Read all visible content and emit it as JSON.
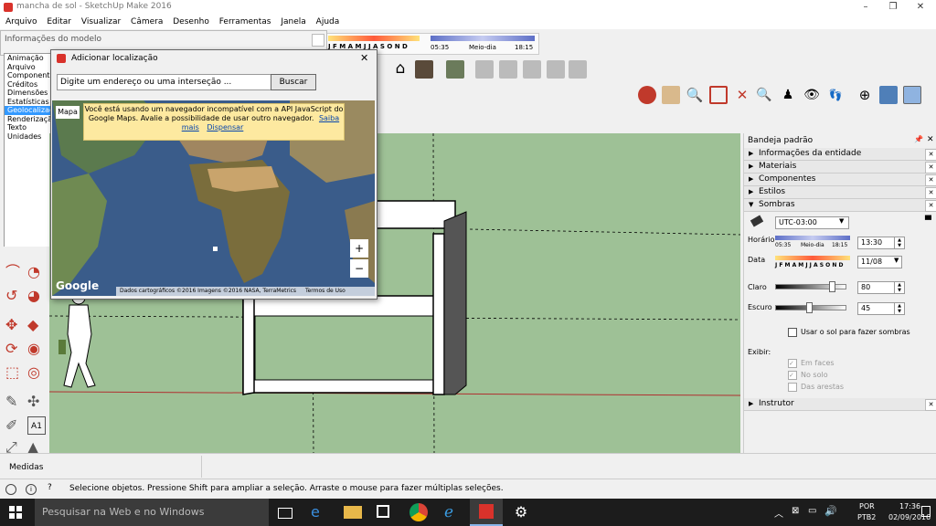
{
  "window": {
    "title": "mancha de sol - SketchUp Make 2016"
  },
  "menu": [
    "Arquivo",
    "Editar",
    "Visualizar",
    "Câmera",
    "Desenho",
    "Ferramentas",
    "Janela",
    "Ajuda"
  ],
  "model_info": {
    "title": "Informações do modelo",
    "items": [
      "Animação",
      "Arquivo",
      "Componentes",
      "Créditos",
      "Dimensões",
      "Estatísticas",
      "Geolocalização",
      "Renderização",
      "Texto",
      "Unidades"
    ],
    "selected_index": 6
  },
  "shadow_toolbar": {
    "months": "J F M A M J J A S O N D",
    "time_start": "05:35",
    "midday": "Meio-dia",
    "time_end": "18:15"
  },
  "dialog": {
    "title": "Adicionar localização",
    "search_placeholder": "Digite um endereço ou uma interseção ...",
    "search_button": "Buscar",
    "map_tab": "Mapa",
    "warning": "Você está usando um navegador incompatível com a API JavaScript do Google Maps. Avalie a possibilidade de usar outro navegador.",
    "learn_more": "Saiba mais",
    "dismiss": "Dispensar",
    "zoom_in": "+",
    "zoom_out": "−",
    "google": "Google",
    "attribution": "Dados cartográficos ©2016 Imagens ©2016 NASA, TerraMetrics",
    "terms": "Termos de Uso"
  },
  "tray": {
    "title": "Bandeja padrão",
    "sections": [
      "Informações da entidade",
      "Materiais",
      "Componentes",
      "Estilos"
    ],
    "shadows": {
      "title": "Sombras",
      "timezone": "UTC-03:00",
      "time_label": "Horário",
      "time_start": "05:35",
      "time_mid": "Meio-dia",
      "time_end": "18:15",
      "time_value": "13:30",
      "date_label": "Data",
      "date_months": "J F M A M J J A S O N D",
      "date_value": "11/08",
      "light_label": "Claro",
      "light_value": "80",
      "light_fraction": 0.8,
      "dark_label": "Escuro",
      "dark_value": "45",
      "dark_fraction": 0.45,
      "use_sun": "Usar o sol para fazer sombras",
      "display_label": "Exibir:",
      "on_faces": "Em faces",
      "on_ground": "No solo",
      "from_edges": "Das arestas"
    },
    "instructor": "Instrutor"
  },
  "measure_label": "Medidas",
  "status_text": "Selecione objetos. Pressione Shift para ampliar a seleção. Arraste o mouse para fazer múltiplas seleções.",
  "taskbar": {
    "search": "Pesquisar na Web e no Windows",
    "lang1": "POR",
    "lang2": "PTB2",
    "time": "17:36",
    "date": "02/09/2016"
  }
}
